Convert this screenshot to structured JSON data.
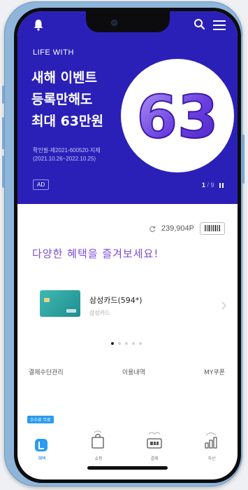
{
  "banner": {
    "brand": "LIFE WITH",
    "headline": [
      "새해 이벤트",
      "등록만해도",
      "최대 63만원"
    ],
    "promo_number": "63",
    "fine_print": [
      "확인필-제2021-600520-지제",
      "(2021.10.26~2022.10.25)"
    ],
    "ad_label": "AD",
    "page_current": "1",
    "page_total": "9",
    "bg_color": "#2a20b8"
  },
  "points": {
    "value": "239,904P"
  },
  "section": {
    "title": "다양한 혜택을 즐겨보세요!"
  },
  "card": {
    "name": "삼성카드(594*)",
    "sub": "삼성카드"
  },
  "carousel": {
    "total_dots": 5,
    "active_index": 0
  },
  "menu": {
    "items": [
      "결제수단관리",
      "이용내역",
      "MY쿠폰"
    ]
  },
  "tabbar": {
    "badge": "수수료 무료",
    "tabs": [
      {
        "label": "혜택",
        "icon": "benefit-icon",
        "active": true
      },
      {
        "label": "쇼핑",
        "icon": "shopping-bag-icon",
        "active": false
      },
      {
        "label": "결제",
        "icon": "payment-icon",
        "active": false
      },
      {
        "label": "자산",
        "icon": "asset-chart-icon",
        "active": false
      }
    ]
  },
  "icons": [
    "bell-icon",
    "search-icon",
    "menu-icon",
    "pause-icon",
    "refresh-icon",
    "barcode-icon",
    "chevron-right-icon"
  ]
}
